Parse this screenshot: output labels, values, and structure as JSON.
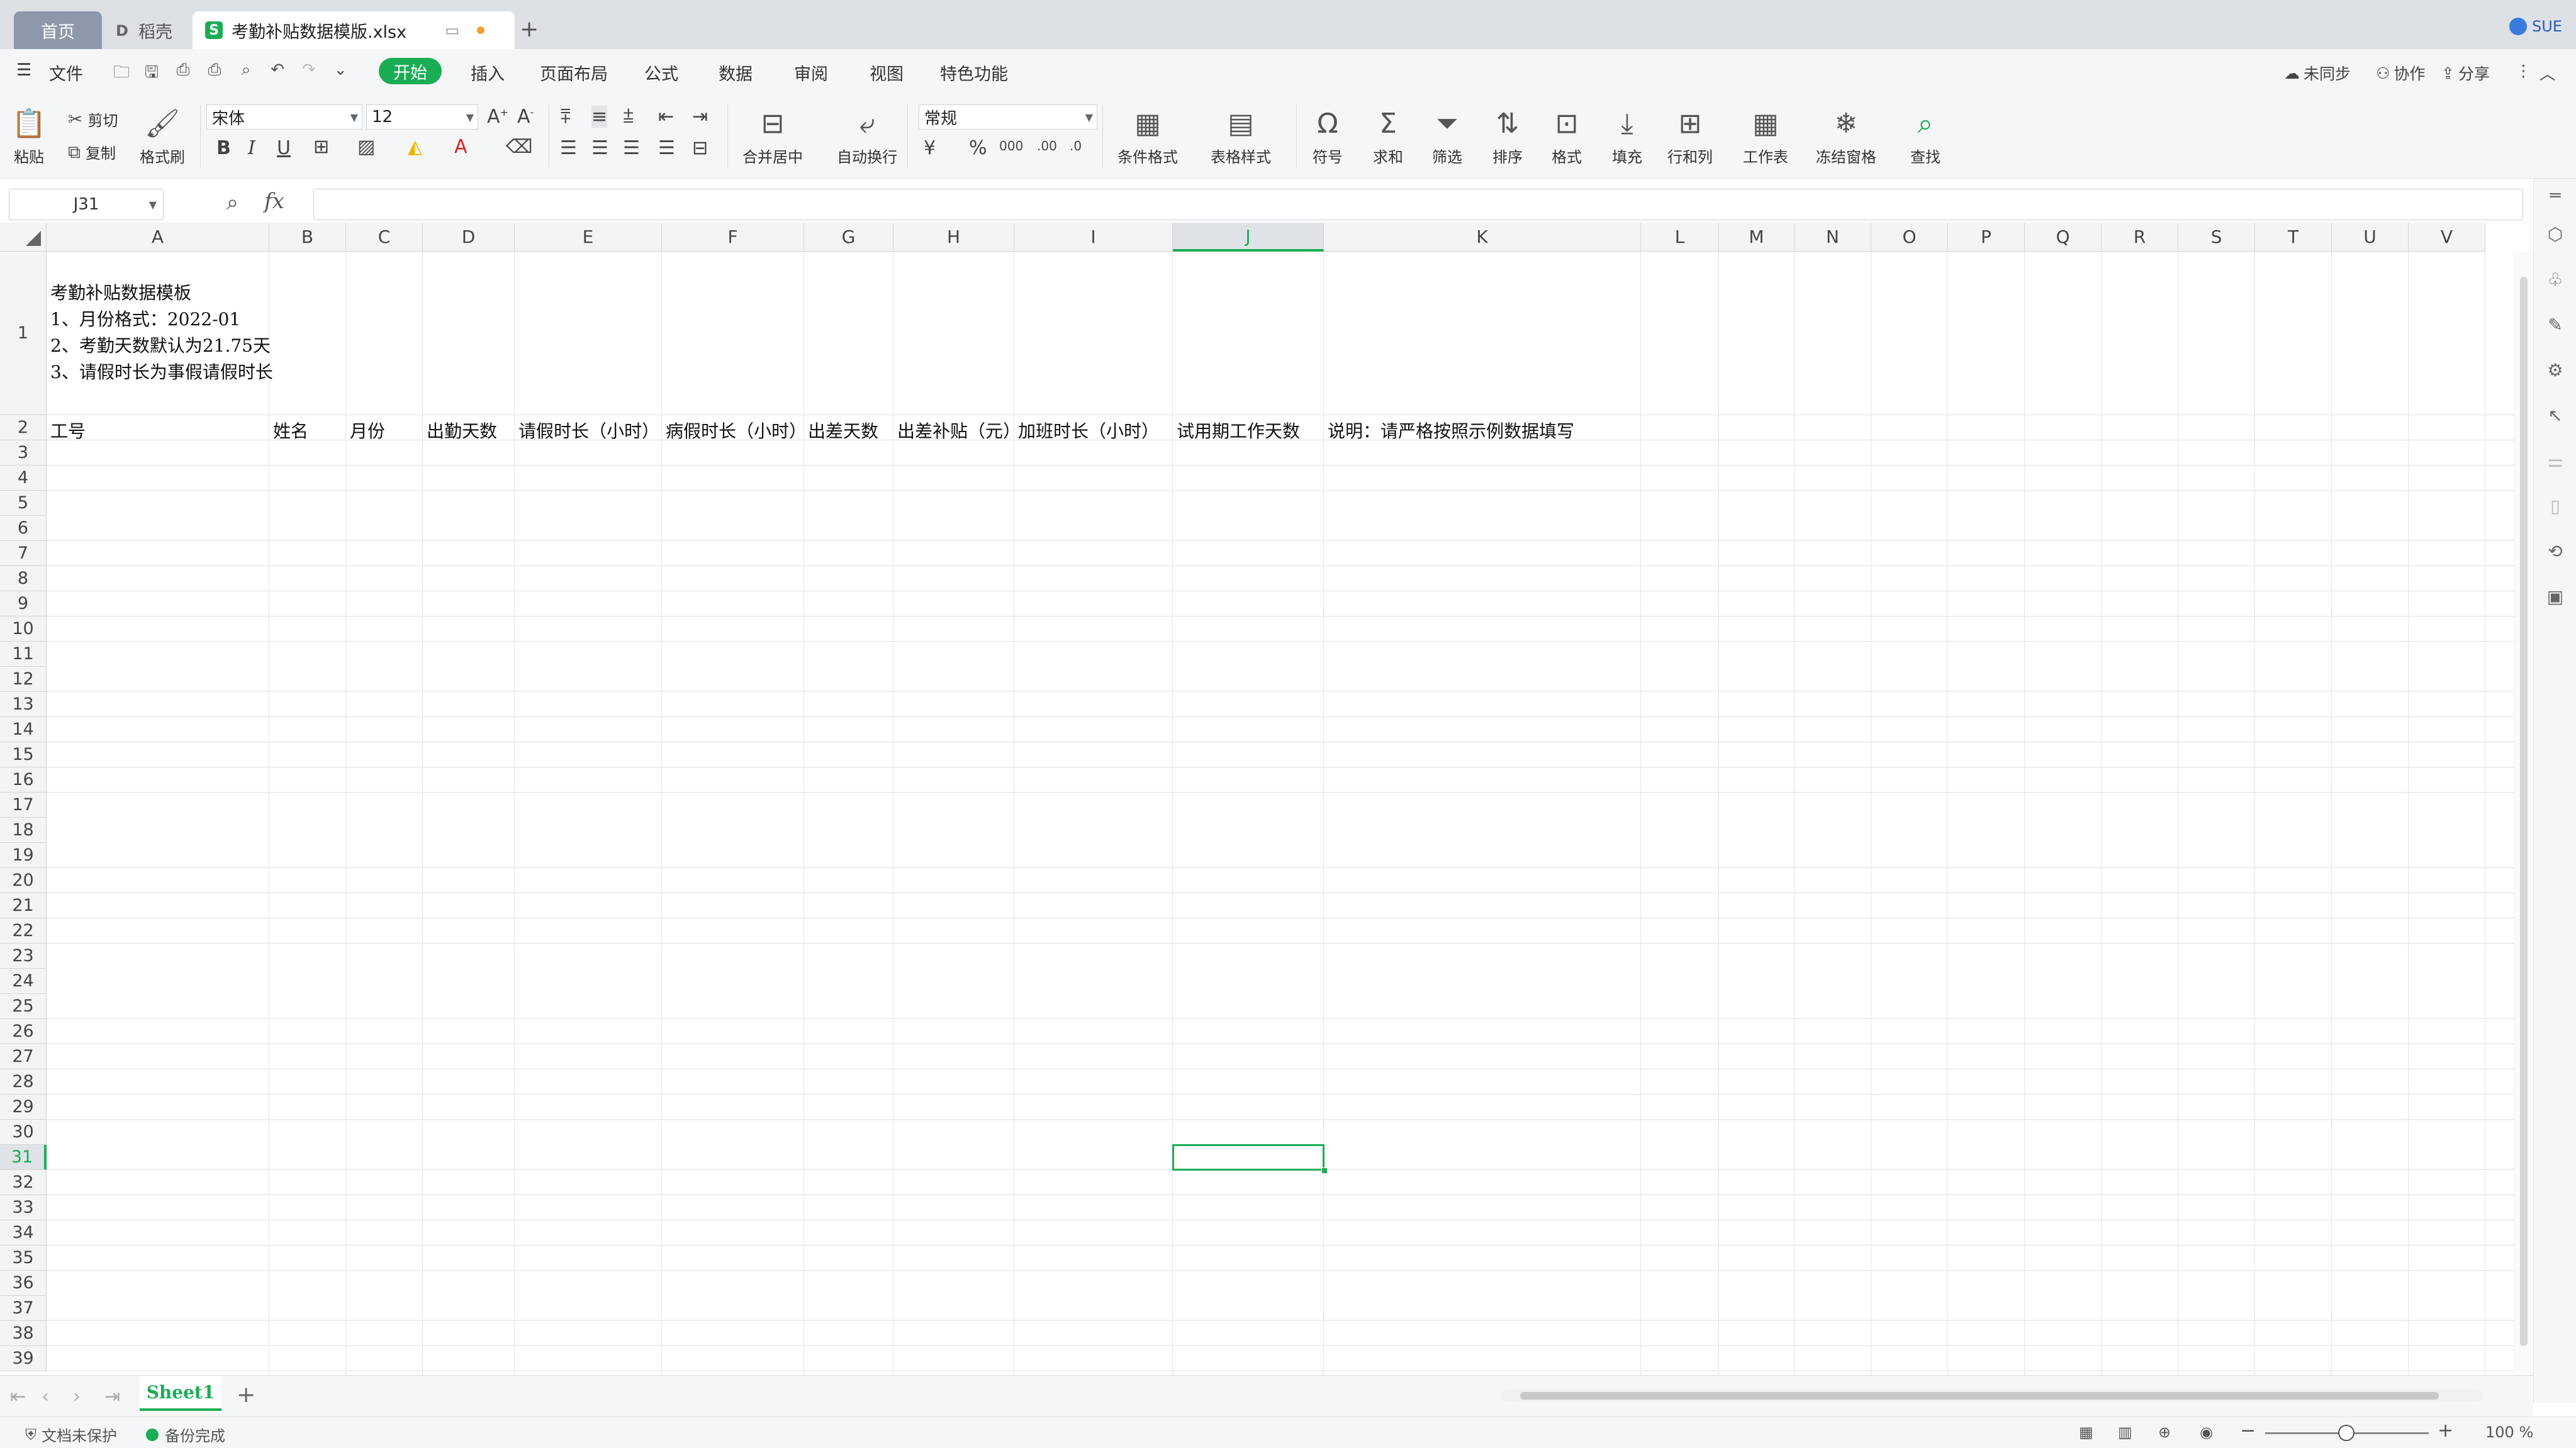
{
  "tabs": {
    "home": "首页",
    "daoke": "稻壳",
    "file": "考勤补贴数据模版.xlsx",
    "user": "SUE"
  },
  "menu": {
    "file": "文件",
    "items": [
      "开始",
      "插入",
      "页面布局",
      "公式",
      "数据",
      "审阅",
      "视图",
      "特色功能"
    ],
    "right": [
      "未同步",
      "协作",
      "分享"
    ]
  },
  "ribbon": {
    "paste": "粘贴",
    "cut": "剪切",
    "copy": "复制",
    "format_painter": "格式刷",
    "font": "宋体",
    "font_size": "12",
    "number_format": "常规",
    "merge": "合并居中",
    "wrap": "自动换行",
    "cond_format": "条件格式",
    "table_style": "表格样式",
    "symbol": "符号",
    "sum": "求和",
    "filter": "筛选",
    "sort": "排序",
    "format": "格式",
    "fill": "填充",
    "row_col": "行和列",
    "worksheet": "工作表",
    "freeze": "冻结窗格",
    "find": "查找"
  },
  "formula": {
    "cell_ref": "J31",
    "fx": "fx",
    "value": ""
  },
  "columns": [
    "A",
    "B",
    "C",
    "D",
    "E",
    "F",
    "G",
    "H",
    "I",
    "J",
    "K",
    "L",
    "M",
    "N",
    "O",
    "P",
    "Q",
    "R",
    "S",
    "T",
    "U",
    "V"
  ],
  "rows": [
    "1",
    "2",
    "3",
    "4",
    "5",
    "6",
    "7",
    "8",
    "9",
    "10",
    "11",
    "12",
    "13",
    "14",
    "15",
    "16",
    "17",
    "18",
    "19",
    "20",
    "21",
    "22",
    "23",
    "24",
    "25",
    "26",
    "27",
    "28",
    "29",
    "30",
    "31",
    "32",
    "33",
    "34",
    "35",
    "36",
    "37",
    "38",
    "39"
  ],
  "sheet": {
    "a1_lines": [
      "考勤补贴数据模板",
      "1、月份格式：2022-01",
      "2、考勤天数默认为21.75天",
      "3、请假时长为事假请假时长"
    ],
    "headers": [
      "工号",
      "姓名",
      "月份",
      "出勤天数",
      "请假时长（小时）",
      "病假时长（小时）",
      "出差天数",
      "出差补贴（元）",
      "加班时长（小时）",
      "试用期工作天数",
      "说明：请严格按照示例数据填写"
    ]
  },
  "sheet_tabs": [
    "Sheet1"
  ],
  "status": {
    "protect": "文档未保护",
    "backup": "备份完成",
    "zoom": "100 %"
  },
  "colors": {
    "accent": "#1aad55",
    "tab_home": "#8d98ab"
  }
}
